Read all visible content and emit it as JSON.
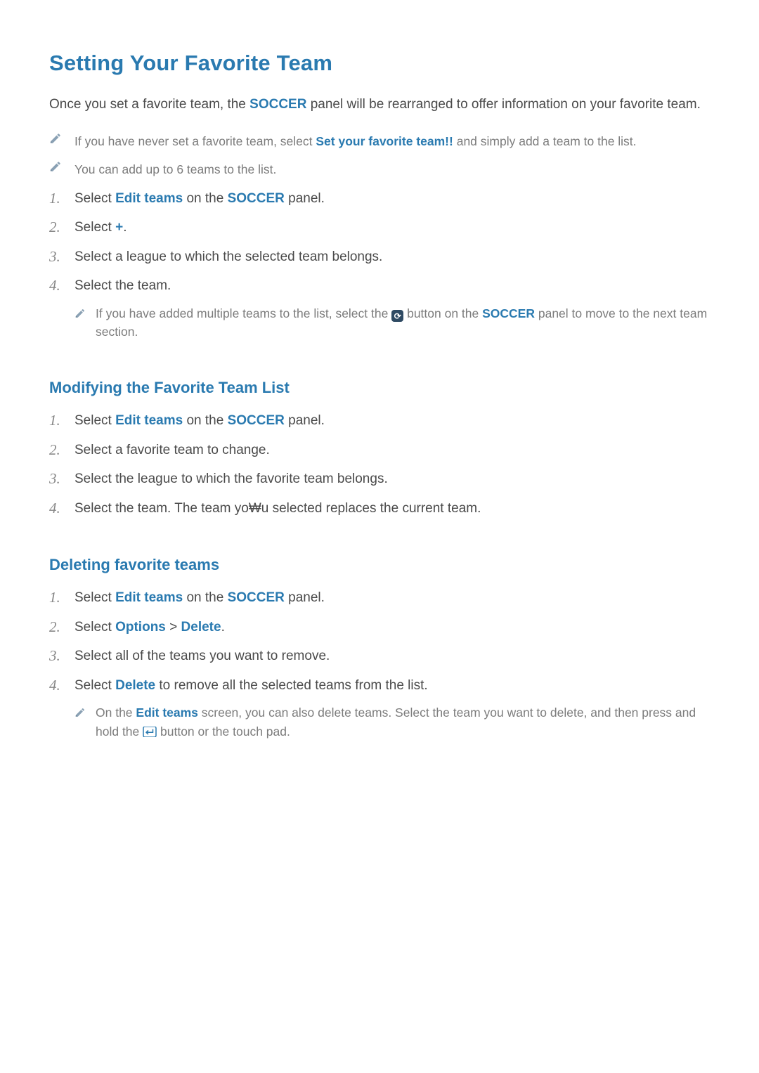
{
  "page": {
    "title": "Setting Your Favorite Team",
    "intro_parts": {
      "p1": "Once you set a favorite team, the ",
      "soccer": "SOCCER",
      "p2": " panel will be rearranged to offer information on your favorite team."
    }
  },
  "top_notes": [
    {
      "p1": "If you have never set a favorite team, select ",
      "bold": "Set your favorite team!!",
      "p2": " and simply add a team to the list."
    },
    {
      "p1": "You can add up to 6 teams to the list.",
      "bold": "",
      "p2": ""
    }
  ],
  "steps_main": [
    {
      "p1": "Select ",
      "b1": "Edit teams",
      "p2": " on the ",
      "b2": "SOCCER",
      "p3": " panel."
    },
    {
      "p1": "Select ",
      "b1": "+",
      "p2": ".",
      "b2": "",
      "p3": ""
    },
    {
      "p1": "Select a league to which the selected team belongs.",
      "b1": "",
      "p2": "",
      "b2": "",
      "p3": ""
    },
    {
      "p1": "Select the team.",
      "b1": "",
      "p2": "",
      "b2": "",
      "p3": ""
    }
  ],
  "main_step4_note": {
    "p1": "If you have added multiple teams to the list, select the ",
    "icon_label": "refresh-icon",
    "icon_glyph": "⟳",
    "p2": " button on the ",
    "bold": "SOCCER",
    "p3": " panel to move to the next team section."
  },
  "section_modify": {
    "title": "Modifying the Favorite Team List",
    "steps": [
      {
        "p1": "Select ",
        "b1": "Edit teams",
        "p2": " on the ",
        "b2": "SOCCER",
        "p3": " panel."
      },
      {
        "p1": "Select a favorite team to change.",
        "b1": "",
        "p2": "",
        "b2": "",
        "p3": ""
      },
      {
        "p1": "Select the league to which the favorite team belongs.",
        "b1": "",
        "p2": "",
        "b2": "",
        "p3": ""
      },
      {
        "p1": "Select the team. The team yo₩u selected replaces the current team.",
        "b1": "",
        "p2": "",
        "b2": "",
        "p3": ""
      }
    ]
  },
  "section_delete": {
    "title": "Deleting favorite teams",
    "steps": [
      {
        "p1": "Select ",
        "b1": "Edit teams",
        "p2": " on the ",
        "b2": "SOCCER",
        "p3": " panel."
      },
      {
        "p1": "Select ",
        "b1": "Options",
        "sep": " > ",
        "b2": "Delete",
        "p3": "."
      },
      {
        "p1": "Select all of the teams you want to remove.",
        "b1": "",
        "p2": "",
        "b2": "",
        "p3": ""
      },
      {
        "p1": "Select ",
        "b1": "Delete",
        "p2": " to remove all the selected teams from the list.",
        "b2": "",
        "p3": ""
      }
    ],
    "step4_note": {
      "p1": "On the ",
      "b1": "Edit teams",
      "p2": " screen, you can also delete teams. Select the team you want to delete, and then press and hold the ",
      "icon_label": "enter-icon",
      "p3": " button or the touch pad."
    }
  }
}
